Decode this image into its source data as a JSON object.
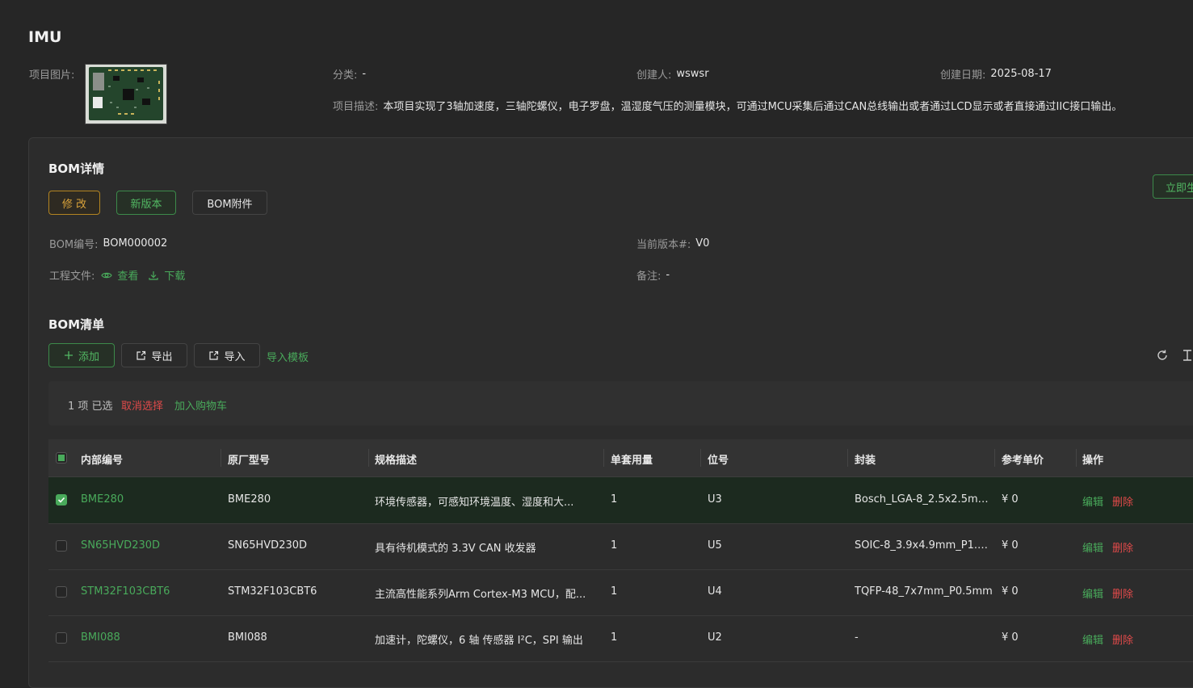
{
  "page": {
    "title": "IMU"
  },
  "project": {
    "image_label": "项目图片:",
    "category_label": "分类:",
    "category_value": "-",
    "creator_label": "创建人:",
    "creator_value": "wswsr",
    "created_date_label": "创建日期:",
    "created_date_value": "2025-08-17",
    "description_label": "项目描述:",
    "description_value": "本项目实现了3轴加速度，三轴陀螺仪，电子罗盘，温湿度气压的测量模块，可通过MCU采集后通过CAN总线输出或者通过LCD显示或者直接通过IIC接口输出。"
  },
  "bom_detail": {
    "title": "BOM详情",
    "edit_button": "修 改",
    "new_version_button": "新版本",
    "attachments_button": "BOM附件",
    "right_button": "立即生",
    "bom_no_label": "BOM编号:",
    "bom_no_value": "BOM000002",
    "version_label": "当前版本#:",
    "version_value": "V0",
    "project_file_label": "工程文件:",
    "view_link": "查看",
    "download_link": "下载",
    "remark_label": "备注:",
    "remark_value": "-"
  },
  "bom_list": {
    "title": "BOM清单",
    "add_button": "添加",
    "export_button": "导出",
    "import_button": "导入",
    "import_template_link": "导入模板",
    "selection_text": "1 项 已选",
    "cancel_selection": "取消选择",
    "add_to_cart": "加入购物车",
    "columns": [
      "内部编号",
      "原厂型号",
      "规格描述",
      "单套用量",
      "位号",
      "封装",
      "参考单价",
      "操作"
    ],
    "rows": [
      {
        "selected": true,
        "internal_no": "BME280",
        "mfr_part": "BME280",
        "description": "环境传感器，可感知环境温度、湿度和大...",
        "qty": "1",
        "ref": "U3",
        "package": "Bosch_LGA-8_2.5x2.5mm...",
        "price": "¥ 0",
        "edit": "编辑",
        "delete": "删除"
      },
      {
        "selected": false,
        "internal_no": "SN65HVD230D",
        "mfr_part": "SN65HVD230D",
        "description": "具有待机模式的 3.3V CAN 收发器",
        "qty": "1",
        "ref": "U5",
        "package": "SOIC-8_3.9x4.9mm_P1.27...",
        "price": "¥ 0",
        "edit": "编辑",
        "delete": "删除"
      },
      {
        "selected": false,
        "internal_no": "STM32F103CBT6",
        "mfr_part": "STM32F103CBT6",
        "description": "主流高性能系列Arm Cortex-M3 MCU，配...",
        "qty": "1",
        "ref": "U4",
        "package": "TQFP-48_7x7mm_P0.5mm",
        "price": "¥ 0",
        "edit": "编辑",
        "delete": "删除"
      },
      {
        "selected": false,
        "internal_no": "BMI088",
        "mfr_part": "BMI088",
        "description": "加速计，陀螺仪，6 轴 传感器 I²C，SPI 输出",
        "qty": "1",
        "ref": "U2",
        "package": "-",
        "price": "¥ 0",
        "edit": "编辑",
        "delete": "删除"
      }
    ]
  },
  "colors": {
    "accent": "#49aa5b",
    "danger": "#e04a4a",
    "warning": "#d9a23a",
    "background": "#262626"
  },
  "icons": {
    "add": "plus-icon",
    "export": "export-icon",
    "import": "import-icon",
    "view": "eye-icon",
    "download": "download-icon",
    "refresh": "refresh-icon",
    "columns": "column-settings-icon"
  }
}
